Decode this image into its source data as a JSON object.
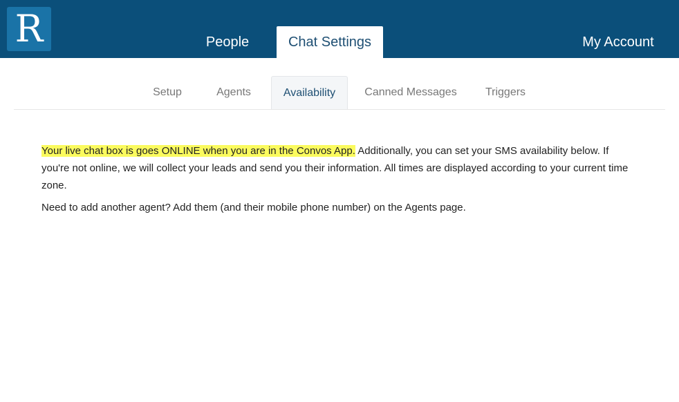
{
  "header": {
    "logo_letter": "R",
    "nav": {
      "people": "People",
      "chat_settings": "Chat Settings",
      "my_account": "My Account"
    }
  },
  "subnav": {
    "setup": "Setup",
    "agents": "Agents",
    "availability": "Availability",
    "canned_messages": "Canned Messages",
    "triggers": "Triggers"
  },
  "content": {
    "intro_highlighted": "Your live chat box is goes ONLINE when you are in the Convos App.",
    "intro_rest": " Additionally, you can set your SMS availability below. If you're not online, we will collect your leads and send you their information. All times are displayed according to your current time zone.",
    "agents_note": "Need to add another agent? Add them (and their mobile phone number) on the Agents page."
  },
  "colors": {
    "header_bg": "#0b4f7a",
    "logo_bg": "#1a73a7",
    "highlight": "#fbfb5e",
    "active_text": "#1e4f73"
  }
}
